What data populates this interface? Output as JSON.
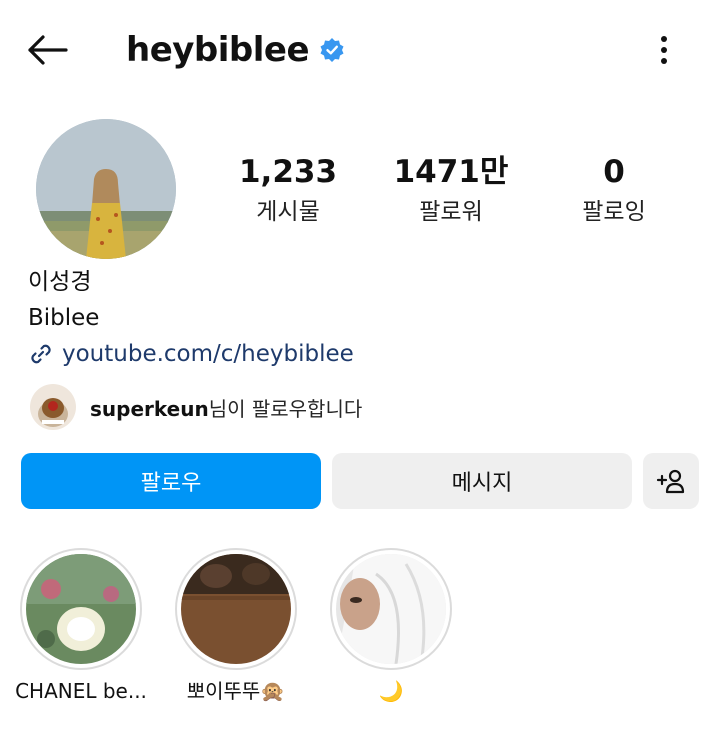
{
  "header": {
    "username": "heybiblee",
    "verified": true,
    "back_icon": "arrow-left-icon",
    "more_icon": "more-vertical-icon"
  },
  "stats": [
    {
      "value": "1,233",
      "label": "게시물"
    },
    {
      "value": "1471만",
      "label": "팔로워"
    },
    {
      "value": "0",
      "label": "팔로잉"
    }
  ],
  "profile": {
    "full_name": "이성경",
    "bio": "Biblee",
    "link": "youtube.com/c/heybiblee",
    "link_icon": "link-icon"
  },
  "followed_by": {
    "user": "superkeun",
    "suffix": "님이 팔로우합니다"
  },
  "actions": {
    "follow_label": "팔로우",
    "message_label": "메시지",
    "add_user_icon": "add-person-icon"
  },
  "highlights": [
    {
      "label": "CHANEL be..."
    },
    {
      "label": "뽀이뚜뚜🙊"
    },
    {
      "label": "🌙"
    }
  ],
  "colors": {
    "accent": "#0095f6",
    "verified": "#3897f0",
    "link": "#1e3a6b",
    "secondary_button": "#efefef"
  }
}
